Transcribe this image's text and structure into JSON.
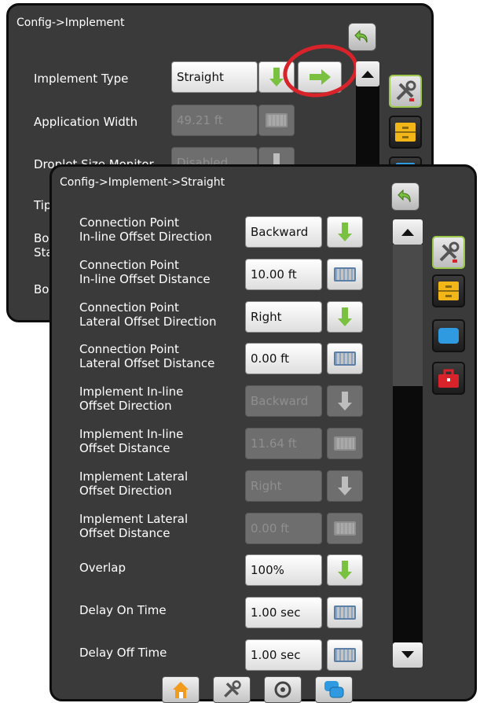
{
  "back_window": {
    "title": "Config->Implement",
    "rows": [
      {
        "label": "Implement Type",
        "value": "Straight"
      },
      {
        "label": "Application Width",
        "value": "49.21 ft"
      },
      {
        "label": "Droplet Size Monitor",
        "value": "Disabled"
      },
      {
        "label": "Tip"
      },
      {
        "label": "Bo"
      },
      {
        "label": "Sta"
      },
      {
        "label": "Bo"
      }
    ]
  },
  "front_window": {
    "title": "Config->Implement->Straight",
    "rows": [
      {
        "label1": "Connection Point",
        "label2": "In-line Offset Direction",
        "value": "Backward",
        "control": "dropdown",
        "enabled": true
      },
      {
        "label1": "Connection Point",
        "label2": "In-line Offset Distance",
        "value": "10.00 ft",
        "control": "keyboard",
        "enabled": true
      },
      {
        "label1": "Connection Point",
        "label2": "Lateral Offset Direction",
        "value": "Right",
        "control": "dropdown",
        "enabled": true
      },
      {
        "label1": "Connection Point",
        "label2": "Lateral Offset Distance",
        "value": "0.00 ft",
        "control": "keyboard",
        "enabled": true
      },
      {
        "label1": "Implement In-line",
        "label2": "Offset Direction",
        "value": "Backward",
        "control": "dropdown",
        "enabled": false
      },
      {
        "label1": "Implement In-line",
        "label2": "Offset Distance",
        "value": "11.64 ft",
        "control": "keyboard",
        "enabled": false
      },
      {
        "label1": "Implement Lateral",
        "label2": "Offset Direction",
        "value": "Right",
        "control": "dropdown",
        "enabled": false
      },
      {
        "label1": "Implement Lateral",
        "label2": "Offset Distance",
        "value": "0.00 ft",
        "control": "keyboard",
        "enabled": false
      },
      {
        "label1": "Overlap",
        "label2": "",
        "value": "100%",
        "control": "dropdown",
        "enabled": true
      },
      {
        "label1": "Delay On Time",
        "label2": "",
        "value": "1.00 sec",
        "control": "keyboard",
        "enabled": true
      },
      {
        "label1": "Delay Off Time",
        "label2": "",
        "value": "1.00 sec",
        "control": "keyboard",
        "enabled": true
      }
    ]
  },
  "side_tabs": [
    "tools-icon",
    "file-cabinet-icon",
    "display-icon",
    "toolbox-icon"
  ],
  "bottom_tabs": [
    "home-icon",
    "tools-icon",
    "guidance-icon",
    "chat-icon"
  ],
  "colors": {
    "window_bg": "#3a3a3a",
    "highlight_ring": "#d9232a",
    "green_arrow": "#7ac142",
    "active_tab_border": "#9bc84a"
  }
}
